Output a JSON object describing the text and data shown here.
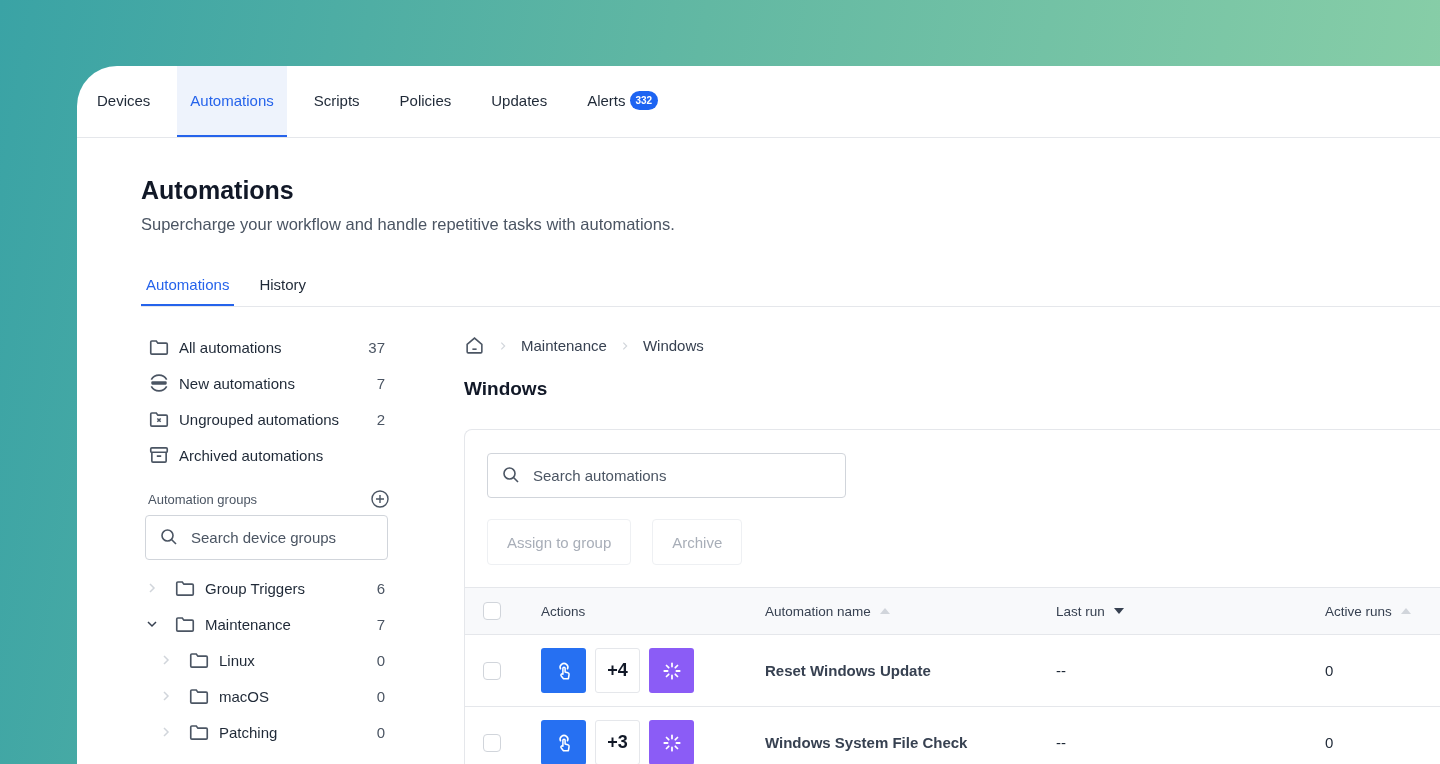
{
  "nav": {
    "tabs": [
      {
        "label": "Devices",
        "selected": false
      },
      {
        "label": "Automations",
        "selected": true
      },
      {
        "label": "Scripts",
        "selected": false
      },
      {
        "label": "Policies",
        "selected": false
      },
      {
        "label": "Updates",
        "selected": false
      },
      {
        "label": "Alerts",
        "selected": false,
        "badge": "332"
      }
    ]
  },
  "page": {
    "title": "Automations",
    "subtitle": "Supercharge your workflow and handle repetitive tasks with automations."
  },
  "subtabs": [
    {
      "label": "Automations",
      "selected": true
    },
    {
      "label": "History",
      "selected": false
    }
  ],
  "sidebar": {
    "items": [
      {
        "kind": "folder",
        "label": "All automations",
        "count": "37"
      },
      {
        "kind": "new",
        "label": "New automations",
        "count": "7"
      },
      {
        "kind": "ungrouped",
        "label": "Ungrouped automations",
        "count": "2"
      },
      {
        "kind": "archive",
        "label": "Archived automations"
      }
    ],
    "groups_heading": "Automation groups",
    "search": {
      "placeholder": "Search device groups"
    },
    "tree": [
      {
        "label": "Group Triggers",
        "count": "6",
        "expanded": false
      },
      {
        "label": "Maintenance",
        "count": "7",
        "expanded": true,
        "children": [
          {
            "label": "Linux",
            "count": "0",
            "expanded": false
          },
          {
            "label": "macOS",
            "count": "0",
            "expanded": false
          },
          {
            "label": "Patching",
            "count": "0",
            "expanded": false
          }
        ]
      }
    ]
  },
  "breadcrumb": [
    "Maintenance",
    "Windows"
  ],
  "main": {
    "title": "Windows",
    "search": {
      "placeholder": "Search automations"
    },
    "buttons": [
      {
        "label": "Assign to group",
        "disabled": true
      },
      {
        "label": "Archive",
        "disabled": true
      }
    ]
  },
  "table": {
    "columns": [
      {
        "label": "Actions"
      },
      {
        "label": "Automation name",
        "sortable": true,
        "ascending": true,
        "active": false
      },
      {
        "label": "Last run",
        "sortable": true,
        "ascending": false,
        "active": true
      },
      {
        "label": "Active runs",
        "sortable": true,
        "ascending": true,
        "active": false
      }
    ],
    "header_checked": false,
    "rows": [
      {
        "checked": false,
        "more": "+4",
        "name": "Reset Windows Update",
        "last_run": "--",
        "active_runs": "0"
      },
      {
        "checked": false,
        "more": "+3",
        "name": "Windows System File Check",
        "last_run": "--",
        "active_runs": "0"
      }
    ]
  }
}
